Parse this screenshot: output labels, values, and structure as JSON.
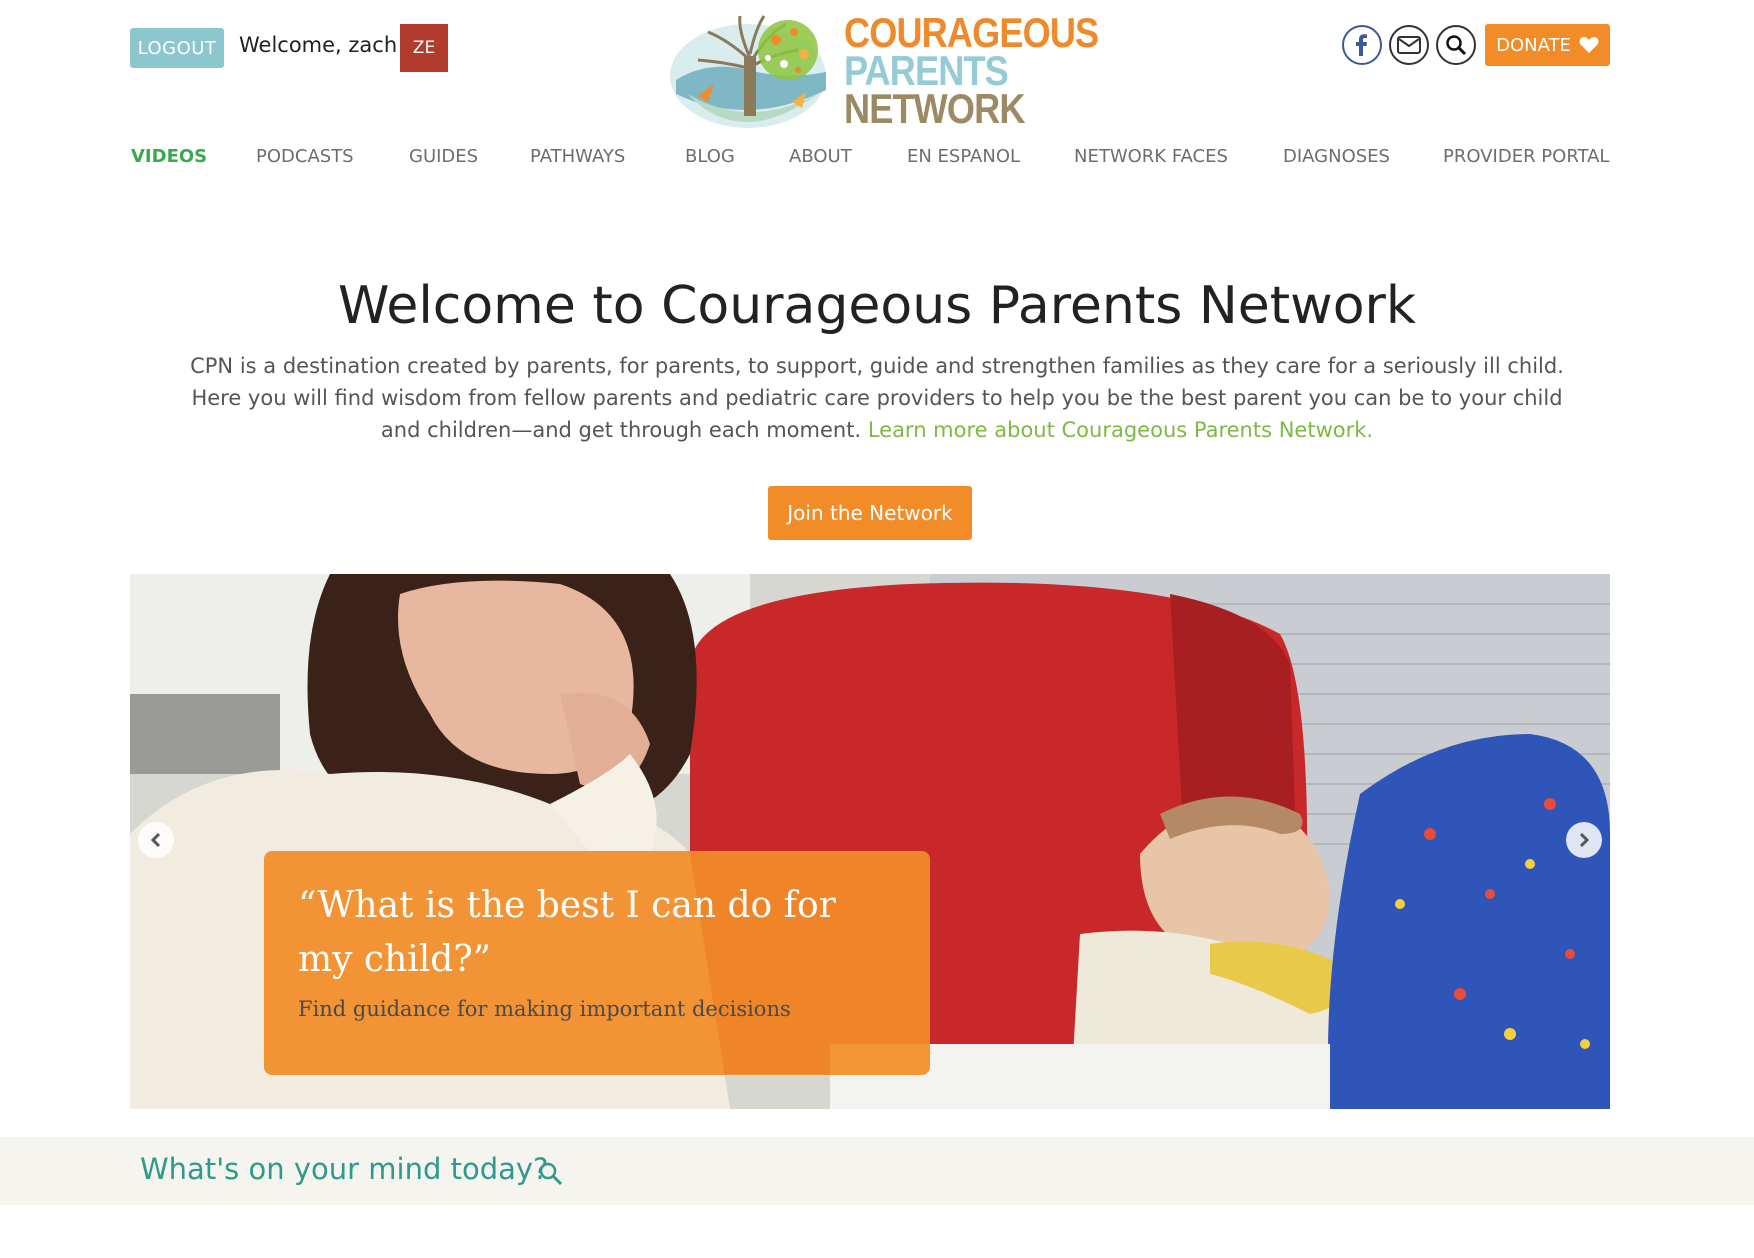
{
  "header": {
    "logout_label": "LOGOUT",
    "welcome_text": "Welcome, zach",
    "avatar_initials": "ZE",
    "logo_lines": [
      "COURAGEOUS",
      "PARENTS",
      "NETWORK"
    ],
    "donate_label": "DONATE",
    "icons": [
      "facebook-icon",
      "mail-icon",
      "search-icon",
      "heart-icon"
    ]
  },
  "nav": {
    "items": [
      {
        "label": "VIDEOS",
        "active": true
      },
      {
        "label": "PODCASTS"
      },
      {
        "label": "GUIDES"
      },
      {
        "label": "PATHWAYS"
      },
      {
        "label": "BLOG"
      },
      {
        "label": "ABOUT"
      },
      {
        "label": "EN ESPANOL"
      },
      {
        "label": "NETWORK FACES"
      },
      {
        "label": "DIAGNOSES"
      },
      {
        "label": "PROVIDER PORTAL"
      }
    ]
  },
  "intro": {
    "title": "Welcome to Courageous Parents Network",
    "body": "CPN is a destination created by parents, for parents, to support, guide and strengthen families as they care for a seriously ill child. Here you will find wisdom from fellow parents and pediatric care providers to help you be the best parent you can be to your child and children—and get through each moment.",
    "link_text": "Learn more about Courageous Parents Network.",
    "join_label": "Join the Network"
  },
  "hero": {
    "quote": "“What is the best I can do for my child?”",
    "subtitle": "Find guidance for making important decisions"
  },
  "mind": {
    "prompt": "What's on your mind today?"
  },
  "colors": {
    "accent_orange": "#f28c28",
    "teal": "#2e9a8c",
    "logout_blue": "#8cc6cf",
    "nav_active_green": "#3aa84e",
    "link_green": "#7db944",
    "avatar_red": "#b23b2f"
  }
}
